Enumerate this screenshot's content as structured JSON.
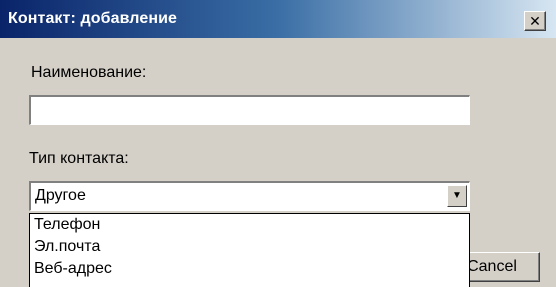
{
  "window": {
    "title": "Контакт: добавление",
    "close_icon": "close-icon",
    "close_glyph": "✕"
  },
  "form": {
    "name_label": "Наименование:",
    "name_value": "",
    "type_label": "Тип контакта:",
    "type_selected": "Другое",
    "dropdown_arrow_icon": "chevron-down-icon",
    "arrow_glyph": "▼",
    "type_options": [
      "Телефон",
      "Эл.почта",
      "Веб-адрес"
    ]
  },
  "buttons": {
    "cancel_label": "Cancel"
  },
  "colors": {
    "titlebar_start": "#0a246a",
    "titlebar_end": "#d7e6f2",
    "dialog_bg": "#d4d0c8"
  }
}
